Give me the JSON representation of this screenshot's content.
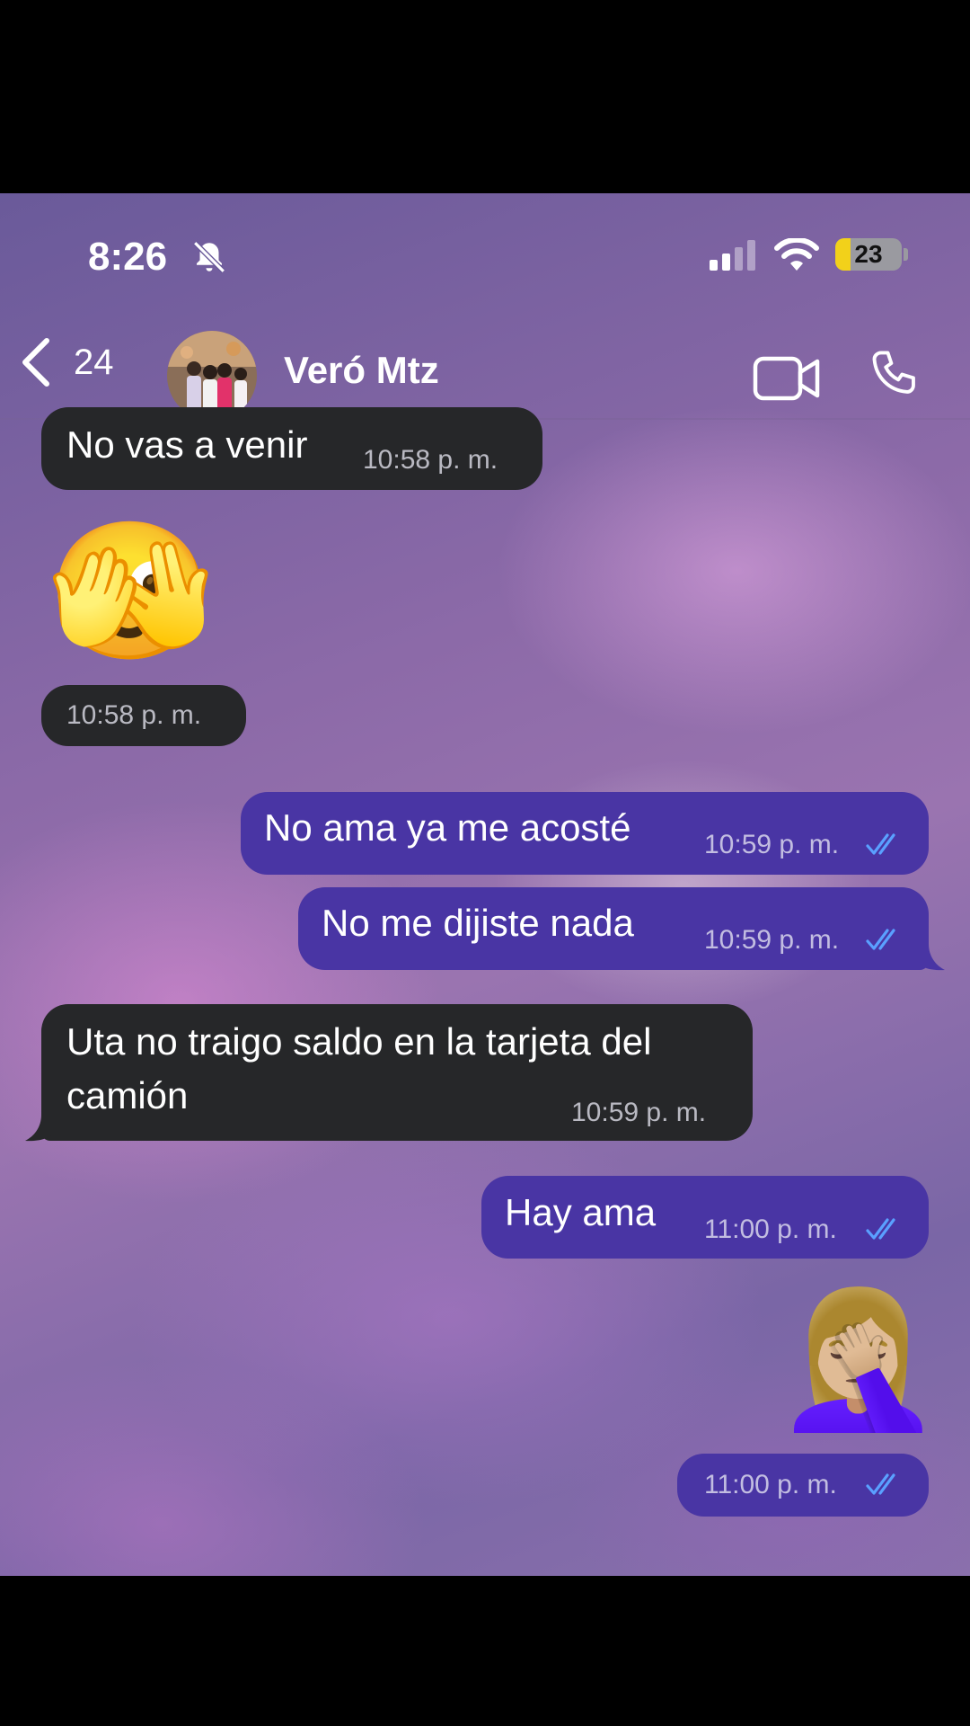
{
  "status_bar": {
    "time": "8:26",
    "battery_level": "23",
    "battery_fraction": 0.23,
    "icons": [
      "bell-slash-icon",
      "cellular-signal-icon",
      "wifi-icon",
      "battery-icon"
    ]
  },
  "header": {
    "back_count": "24",
    "contact_name": "Veró Mtz",
    "icons": [
      "chevron-left-icon",
      "video-camera-icon",
      "phone-icon"
    ]
  },
  "messages": [
    {
      "direction": "in",
      "text": "No vas a venir",
      "time": "10:58 p. m."
    },
    {
      "direction": "in",
      "emoji": "🫣",
      "time": "10:58 p. m."
    },
    {
      "direction": "out",
      "text": "No ama ya me acosté",
      "time": "10:59 p. m.",
      "status": "read"
    },
    {
      "direction": "out",
      "text": "No me dijiste nada",
      "time": "10:59 p. m.",
      "status": "read"
    },
    {
      "direction": "in",
      "text_line1": "Uta no traigo saldo en la tarjeta del",
      "text_line2": "camión",
      "time": "10:59 p. m."
    },
    {
      "direction": "out",
      "text": "Hay ama",
      "time": "11:00 p. m.",
      "status": "read"
    },
    {
      "direction": "out",
      "emoji": "🤦🏼‍♀️",
      "time": "11:00 p. m.",
      "status": "read"
    }
  ],
  "colors": {
    "incoming_bubble": "#262729",
    "outgoing_bubble": "#4935a4",
    "read_check": "#5aa0ff",
    "battery_fill": "#f2d11a"
  }
}
